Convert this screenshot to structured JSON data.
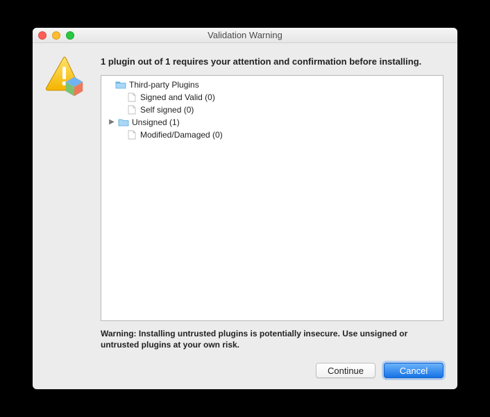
{
  "window": {
    "title": "Validation Warning"
  },
  "message": "1 plugin out of 1 requires your attention and confirmation before installing.",
  "tree": {
    "root": {
      "label": "Third-party Plugins"
    },
    "signed": {
      "label": "Signed and Valid (0)"
    },
    "self": {
      "label": "Self signed (0)"
    },
    "unsigned": {
      "label": "Unsigned (1)"
    },
    "modified": {
      "label": "Modified/Damaged (0)"
    }
  },
  "warning": "Warning: Installing untrusted plugins is potentially insecure. Use unsigned or untrusted plugins at your own risk.",
  "buttons": {
    "continue": "Continue",
    "cancel": "Cancel"
  }
}
